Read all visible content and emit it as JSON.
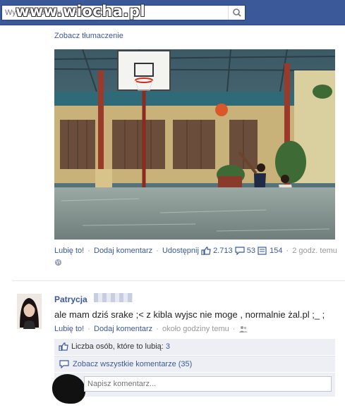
{
  "header": {
    "search_placeholder": "Wyszukaj osoby, miejsca, itp.",
    "watermark": "www.wiocha.pl"
  },
  "post": {
    "translate_link": "Zobacz tłumaczenie",
    "actions": {
      "like": "Lubię to!",
      "comment": "Dodaj komentarz",
      "share": "Udostępnij",
      "likes_count": "2.713",
      "comments_count": "53",
      "shares_count": "154",
      "time": "2 godz. temu"
    }
  },
  "comment": {
    "author": "Patrycja",
    "text": "ale mam dziś srake ;< z kibla wyjsc nie moge , normalnie żal.pl ;_ ;",
    "like": "Lubię to!",
    "reply": "Dodaj komentarz",
    "time": "około godziny temu"
  },
  "likes_summary": {
    "label": "Liczba osób, które to lubią:",
    "count": "3"
  },
  "view_all": "Zobacz wszystkie komentarze (35)",
  "write_comment_placeholder": "Napisz komentarz...",
  "colors": {
    "brand_blue": "#3b5998",
    "panel_bg": "#edeff4",
    "muted": "#999999"
  }
}
